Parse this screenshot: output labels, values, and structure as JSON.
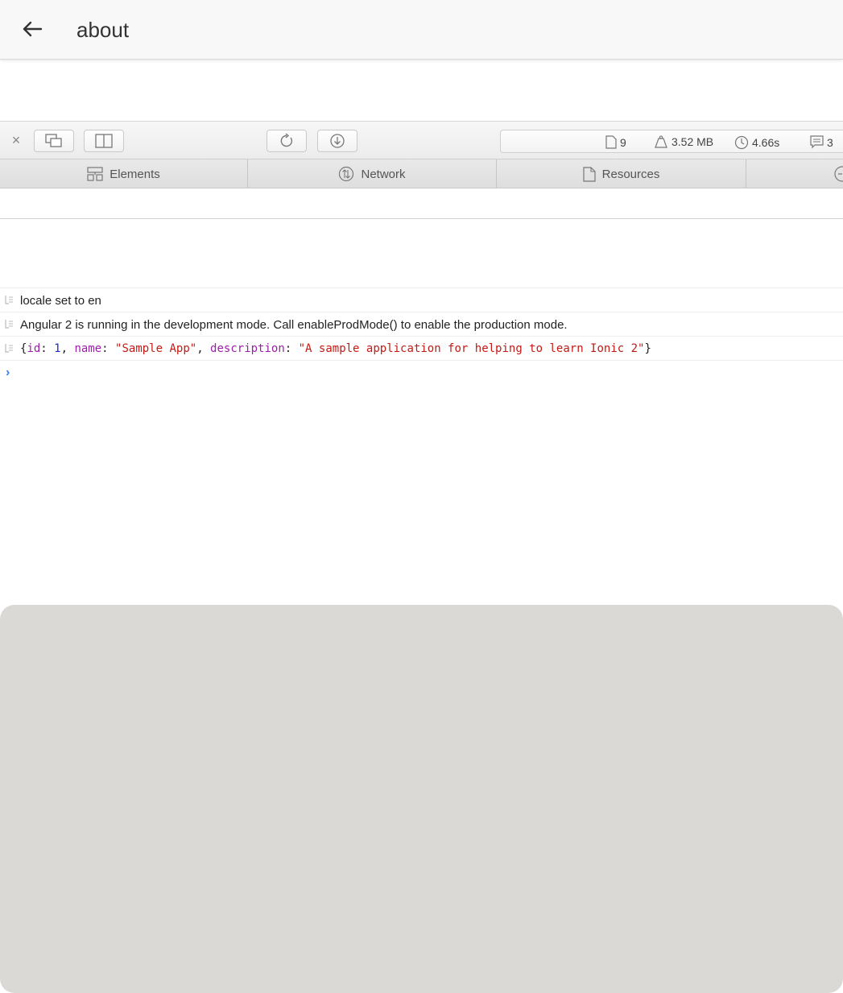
{
  "header": {
    "title": "about",
    "back_icon": "arrow-left-icon"
  },
  "toolbar": {
    "close_label": "×",
    "stats": {
      "resources_count": "9",
      "size": "3.52 MB",
      "time": "4.66s",
      "logs_count": "3"
    }
  },
  "tabs": [
    {
      "label": "Elements",
      "icon": "elements-icon"
    },
    {
      "label": "Network",
      "icon": "network-icon"
    },
    {
      "label": "Resources",
      "icon": "document-icon"
    }
  ],
  "console": {
    "messages": [
      {
        "text": "locale set to en"
      },
      {
        "text": "Angular 2 is running in the development mode. Call enableProdMode() to enable the production mode."
      }
    ],
    "object_log": {
      "open": "{",
      "id_key": "id",
      "id_val": "1",
      "name_key": "name",
      "name_val": "\"Sample App\"",
      "desc_key": "description",
      "desc_val": "\"A sample application for helping to learn Ionic 2\"",
      "close": "}"
    },
    "prompt": "›"
  },
  "colors": {
    "key": "#9b1fa7",
    "number": "#1c2bcf",
    "string": "#c41a16",
    "prompt": "#3b82f6",
    "keyboard_bg": "#dad9d6"
  }
}
